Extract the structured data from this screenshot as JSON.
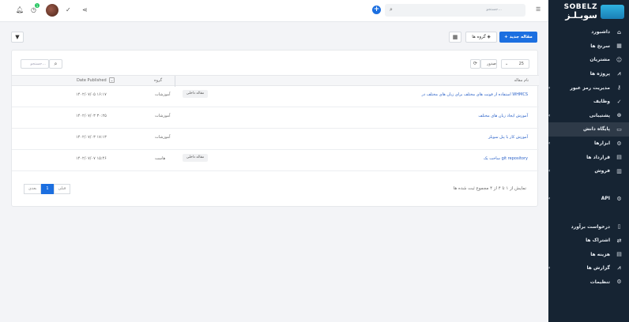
{
  "brand": {
    "en": "SOBELZ",
    "fa": "سوبـلـز"
  },
  "sidebar": {
    "items": [
      {
        "label": "داشبورد",
        "icon": "home-icon",
        "glyph": "⌂",
        "arrow": ""
      },
      {
        "label": "سرنخ ها",
        "icon": "building-icon",
        "glyph": "▦",
        "arrow": ""
      },
      {
        "label": "مشتریان",
        "icon": "user-icon",
        "glyph": "☺",
        "arrow": ""
      },
      {
        "label": "پروژه ها",
        "icon": "chart-icon",
        "glyph": "⩘",
        "arrow": ""
      },
      {
        "label": "مدیریت رمز عبور",
        "icon": "key-icon",
        "glyph": "⚷",
        "arrow": "‹"
      },
      {
        "label": "وظایف",
        "icon": "check-circle-icon",
        "glyph": "✓",
        "arrow": ""
      },
      {
        "label": "پشتیبانی",
        "icon": "support-icon",
        "glyph": "⊛",
        "arrow": "‹"
      },
      {
        "label": "پایگاه دانش",
        "icon": "folder-icon",
        "glyph": "▭",
        "arrow": ""
      },
      {
        "label": "ابزارها",
        "icon": "cogs-icon",
        "glyph": "⚙",
        "arrow": "‹"
      },
      {
        "label": "قرارداد ها",
        "icon": "file-icon",
        "glyph": "▤",
        "arrow": ""
      },
      {
        "label": "فروش",
        "icon": "receipt-icon",
        "glyph": "▥",
        "arrow": "‹"
      },
      {
        "label": "",
        "icon": "blank",
        "glyph": "",
        "arrow": ""
      },
      {
        "label": "API",
        "icon": "gears-icon",
        "glyph": "⚙",
        "arrow": "‹"
      },
      {
        "label": "",
        "icon": "blank",
        "glyph": "",
        "arrow": ""
      },
      {
        "label": "درخواست برآورد",
        "icon": "file-outline-icon",
        "glyph": "▯",
        "arrow": ""
      },
      {
        "label": "اشتراک ها",
        "icon": "repeat-icon",
        "glyph": "⇄",
        "arrow": ""
      },
      {
        "label": "هزینه ها",
        "icon": "doc-icon",
        "glyph": "▤",
        "arrow": ""
      },
      {
        "label": "گزارش ها",
        "icon": "report-chart-icon",
        "glyph": "⩘",
        "arrow": "‹"
      },
      {
        "label": "تنظیمات",
        "icon": "settings-icon",
        "glyph": "⚙",
        "arrow": ""
      }
    ]
  },
  "topbar": {
    "search_placeholder": "جستجو...",
    "notif_count": "1"
  },
  "toolbar": {
    "new_article": "+ مقاله جدید",
    "groups": "گروه ها",
    "table_icon": "▦",
    "filter_icon": "▼"
  },
  "table_controls": {
    "per_page": "25",
    "export": "صدور",
    "search_placeholder": "جستجو..."
  },
  "table": {
    "headers": {
      "name": "نام مقاله",
      "group": "گروه",
      "date": "Date Published"
    },
    "rows": [
      {
        "title": "استفاده از فونت های مختلف برای زبان های مختلف در WHMCS",
        "tag": "مقاله داخلی",
        "group": "آموزشات",
        "date": "۱۴۰۲/۰۷/۰۵ ۱۶:۱۷"
      },
      {
        "title": "آموزش ایجاد زبان های مختلف",
        "tag": "",
        "group": "آموزشات",
        "date": "۱۴۰۲/۰۷/۰۳ ۳۰:۲۵"
      },
      {
        "title": "آموزش کار با پنل سوبلز",
        "tag": "",
        "group": "آموزشات",
        "date": "۱۴۰۲/۰۷/۰۳ ۱۷:۱۳"
      },
      {
        "title": "ساخت یک git repository",
        "tag": "مقاله داخلی",
        "group": "هاست",
        "date": "۱۴۰۲/۰۷/۰۷ ۱۵:۴۶"
      }
    ]
  },
  "footer": {
    "info": "نمایش از ۱ تا ۴ از ۴ مجموع ثبت شده ها",
    "prev": "قبلی",
    "page": "1",
    "next": "بعدی"
  }
}
